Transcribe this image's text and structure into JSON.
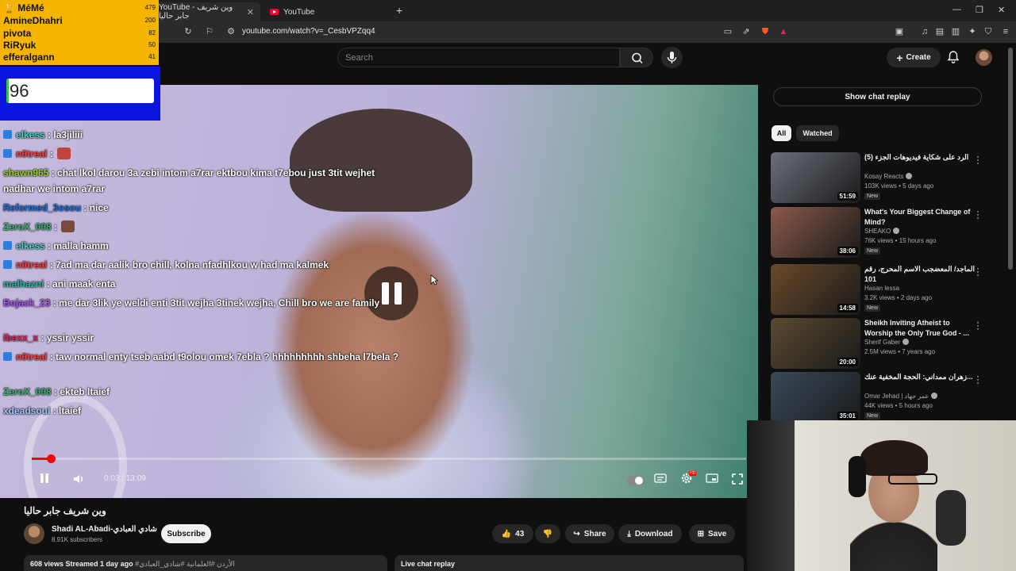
{
  "browser": {
    "tabs": [
      {
        "label": "YouTube - وين شريف جابر حاليا",
        "active": true
      },
      {
        "label": "YouTube",
        "active": false
      }
    ],
    "url": "youtube.com/watch?v=_CesbVPZqq4"
  },
  "header": {
    "search_placeholder": "Search",
    "create_label": "Create"
  },
  "leaderboard": {
    "entries": [
      {
        "name": "MéMé",
        "score": "479",
        "trophy": "🏆"
      },
      {
        "name": "AmineDhahri",
        "score": "200"
      },
      {
        "name": "pivota",
        "score": "82"
      },
      {
        "name": "RiRyuk",
        "score": "50"
      },
      {
        "name": "efferalgann",
        "score": "41"
      }
    ],
    "counter_value": "96"
  },
  "chat": [
    {
      "user": "elkess",
      "text": " : la3jiliii",
      "color": "#4fd1c5",
      "badge": true
    },
    {
      "user": "n0treal",
      "text": " : ",
      "color": "#ff3b3b",
      "badge": true,
      "emote": "#c0443c"
    },
    {
      "user": "shawn965",
      "text": " : chat lkol darou 3a zebi intom a7rar ektbou kima t7ebou just 3tit wejhet nadhar we intom a7rar",
      "color": "#9acd32",
      "badge": false
    },
    {
      "user": "Reformed_3osou",
      "text": " : nice",
      "color": "#1e6fe0",
      "badge": false
    },
    {
      "user": "ZeroX_008",
      "text": " : ",
      "color": "#3cb371",
      "badge": false,
      "emote": "#7a4a3a"
    },
    {
      "user": "elkess",
      "text": " : malla hamm",
      "color": "#4fd1c5",
      "badge": true
    },
    {
      "user": "n0treal",
      "text": " : 7ad ma dar aalik bro chill, kolna nfadhlkou w had ma kalmek",
      "color": "#ff3b3b",
      "badge": true
    },
    {
      "user": "malhazni",
      "text": " : ani maak enta",
      "color": "#2eb8a0",
      "badge": false
    },
    {
      "user": "Bojack_23",
      "text": " : me dar 3lik ye weldi enti 3tit wejha 3tinek wejha, Chill bro we are family",
      "color": "#a855f7",
      "badge": false
    },
    {
      "user": "ibexx_x",
      "text": " : yssir yssir",
      "color": "#e0245e",
      "badge": false
    },
    {
      "user": "n0treal",
      "text": " : taw normal enty tseb aabd t9olou omek 7ebla ? hhhhhhhhh shbeha l7bela ?",
      "color": "#ff3b3b",
      "badge": true
    },
    {
      "user": "ZeroX_008",
      "text": " : ekteb ltaief",
      "color": "#3cb371",
      "badge": false
    },
    {
      "user": "xdeadsoul",
      "text": " : ltaief",
      "color": "#9ec9ff",
      "badge": false
    }
  ],
  "player": {
    "time": "0:03 / 13:09",
    "progress": 0.004
  },
  "video": {
    "title": "وين شريف جابر حاليا",
    "channel": "Shadi AL-Abadi-شادي العبادي",
    "subscribers": "8.91K subscribers",
    "subscribe_label": "Subscribe",
    "likes": "43",
    "share_label": "Share",
    "download_label": "Download",
    "save_label": "Save",
    "views_line": "608 views  Streamed 1 day ago",
    "tags": "#الأردن #العلمانية #شادي_العبادي",
    "live_chat_label": "Live chat replay"
  },
  "sidebar": {
    "show_chat_label": "Show chat replay",
    "chips": [
      "All",
      "Watched"
    ],
    "recommendations": [
      {
        "title": "الرد على شكاية فيديوهات الجزء (5)",
        "channel": "Kosay Reacts",
        "verified": true,
        "meta": "103K views • 5 days ago",
        "badge": "New",
        "duration": "51:59",
        "thumb_color": "#6b6f7a"
      },
      {
        "title": "What's Your Biggest Change of Mind?",
        "channel": "SHEAKO",
        "verified": true,
        "meta": "76K views • 15 hours ago",
        "badge": "New",
        "duration": "38:06",
        "thumb_color": "#8a5a4a"
      },
      {
        "title": "الماجد/ المعضجب الاسم المحرج، رقم 101",
        "channel": "Hasan lessa",
        "verified": false,
        "meta": "3.2K views • 2 days ago",
        "badge": "New",
        "duration": "14:58",
        "thumb_color": "#6a4a2a"
      },
      {
        "title": "Sheikh Inviting Atheist to Worship the Only True God - ...",
        "channel": "Sherif Gaber",
        "verified": true,
        "meta": "2.5M views • 7 years ago",
        "badge": "",
        "duration": "20:00",
        "thumb_color": "#5a4a30"
      },
      {
        "title": "زهران ممداني: الحجة المخفية عنك...",
        "channel": "Omar Jehad | عمر جهاد",
        "verified": true,
        "meta": "44K views • 5 hours ago",
        "badge": "New",
        "duration": "35:01",
        "thumb_color": "#3a4a5a"
      }
    ]
  }
}
